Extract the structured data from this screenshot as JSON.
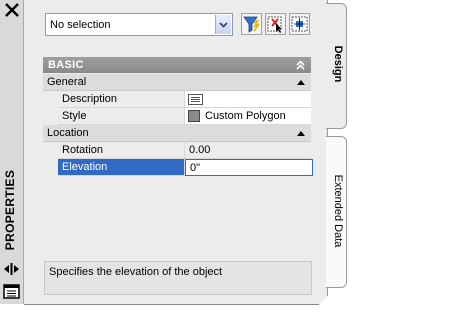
{
  "palette": {
    "tool": "PROPERTIES"
  },
  "selection": {
    "value": "No selection"
  },
  "toolbar": {
    "buttons": [
      {
        "icon": "quick-select-icon"
      },
      {
        "icon": "select-objects-icon"
      },
      {
        "icon": "toggle-pickadd-icon"
      }
    ]
  },
  "grid": {
    "section": "BASIC",
    "categories": [
      {
        "label": "General",
        "rows": [
          {
            "name": "Description",
            "value": ""
          },
          {
            "name": "Style",
            "value": "Custom Polygon"
          }
        ]
      },
      {
        "label": "Location",
        "rows": [
          {
            "name": "Rotation",
            "value": "0.00"
          },
          {
            "name": "Elevation",
            "value": "0\""
          }
        ]
      }
    ],
    "selected_row": "Elevation"
  },
  "description": "Specifies the elevation of the object",
  "tabs": [
    {
      "label": "Design",
      "active": true
    },
    {
      "label": "Extended Data",
      "active": false
    }
  ],
  "colors": {
    "selection": "#316ac5",
    "header": "#8a8a8a"
  }
}
